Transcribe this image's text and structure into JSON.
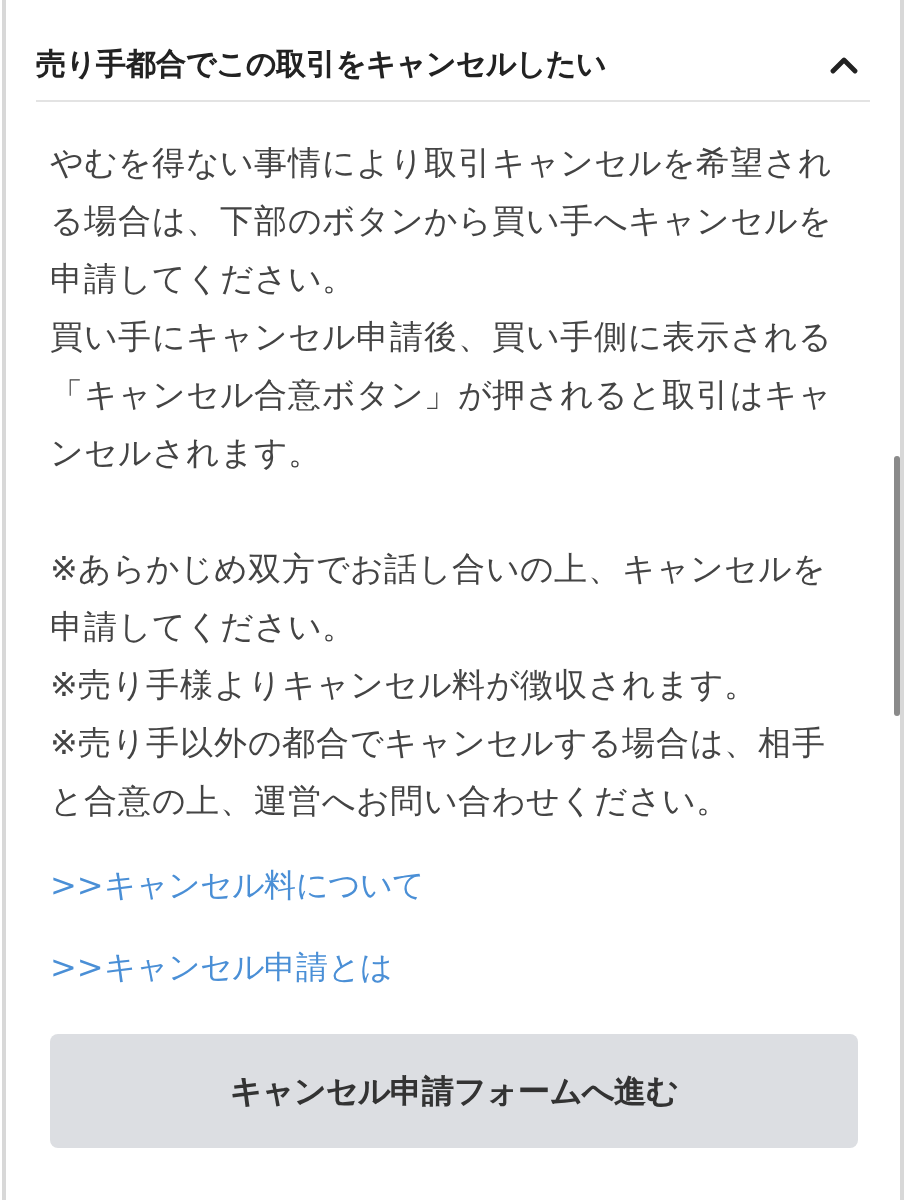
{
  "section": {
    "title": "売り手都合でこの取引をキャンセルしたい",
    "expanded": true,
    "paragraphs": [
      "やむを得ない事情により取引キャンセルを希望される場合は、下部のボタンから買い手へキャンセルを申請してください。",
      "買い手にキャンセル申請後、買い手側に表示される「キャンセル合意ボタン」が押されると取引はキャンセルされます。"
    ],
    "notes": [
      "※あらかじめ双方でお話し合いの上、キャンセルを申請してください。",
      "※売り手様よりキャンセル料が徴収されます。",
      "※売り手以外の都合でキャンセルする場合は、相手と合意の上、運営へお問い合わせください。"
    ],
    "links": [
      ">>キャンセル料について",
      ">>キャンセル申請とは"
    ],
    "button": "キャンセル申請フォームへ進む"
  }
}
